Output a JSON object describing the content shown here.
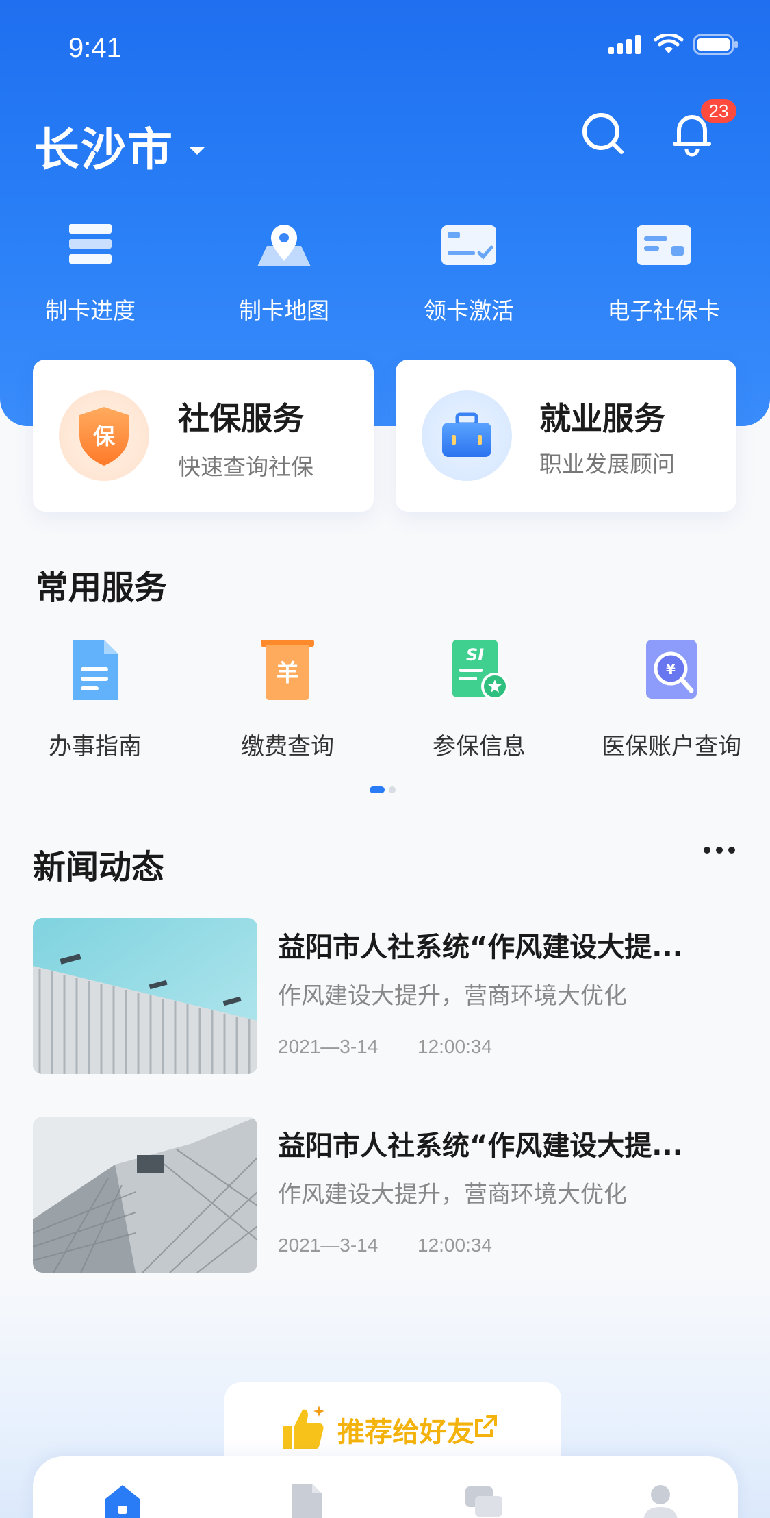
{
  "status_bar": {
    "time": "9:41"
  },
  "header": {
    "city": "长沙市",
    "notification_count": "23"
  },
  "quick_actions": [
    {
      "label": "制卡进度",
      "icon": "list-icon"
    },
    {
      "label": "制卡地图",
      "icon": "map-pin-icon"
    },
    {
      "label": "领卡激活",
      "icon": "card-check-icon"
    },
    {
      "label": "电子社保卡",
      "icon": "card-icon"
    }
  ],
  "feature_cards": [
    {
      "title": "社保服务",
      "subtitle": "快速查询社保",
      "icon": "shield-icon",
      "icon_text": "保",
      "color": "#ff8a2b"
    },
    {
      "title": "就业服务",
      "subtitle": "职业发展顾问",
      "icon": "briefcase-icon",
      "color": "#2f7cf6"
    }
  ],
  "common_services": {
    "title": "常用服务",
    "items": [
      {
        "label": "办事指南",
        "icon": "document-icon",
        "color": "#4aa3f5"
      },
      {
        "label": "缴费查询",
        "icon": "payment-icon",
        "icon_text": "羊",
        "color": "#ff9d3a"
      },
      {
        "label": "参保信息",
        "icon": "insurance-doc-icon",
        "icon_text": "SI",
        "color": "#3ccf8e"
      },
      {
        "label": "医保账户查询",
        "icon": "search-account-icon",
        "color": "#6b7ef5"
      }
    ],
    "page_index": 1,
    "page_count": 2
  },
  "news": {
    "title": "新闻动态",
    "items": [
      {
        "title": "益阳市人社系统“作风建设大提...",
        "summary": "作风建设大提升，营商环境大优化",
        "date": "2021—3-14",
        "time": "12:00:34"
      },
      {
        "title": "益阳市人社系统“作风建设大提...",
        "summary": "作风建设大提升，营商环境大优化",
        "date": "2021—3-14",
        "time": "12:00:34"
      }
    ]
  },
  "recommend": {
    "label": "推荐给好友"
  },
  "tabs": [
    {
      "icon": "home-icon",
      "active": true
    },
    {
      "icon": "file-icon",
      "active": false
    },
    {
      "icon": "chat-icon",
      "active": false
    },
    {
      "icon": "profile-icon",
      "active": false
    }
  ],
  "colors": {
    "primary": "#2a7cf6",
    "badge": "#ff4b3e",
    "recommend": "#f3b20c"
  }
}
